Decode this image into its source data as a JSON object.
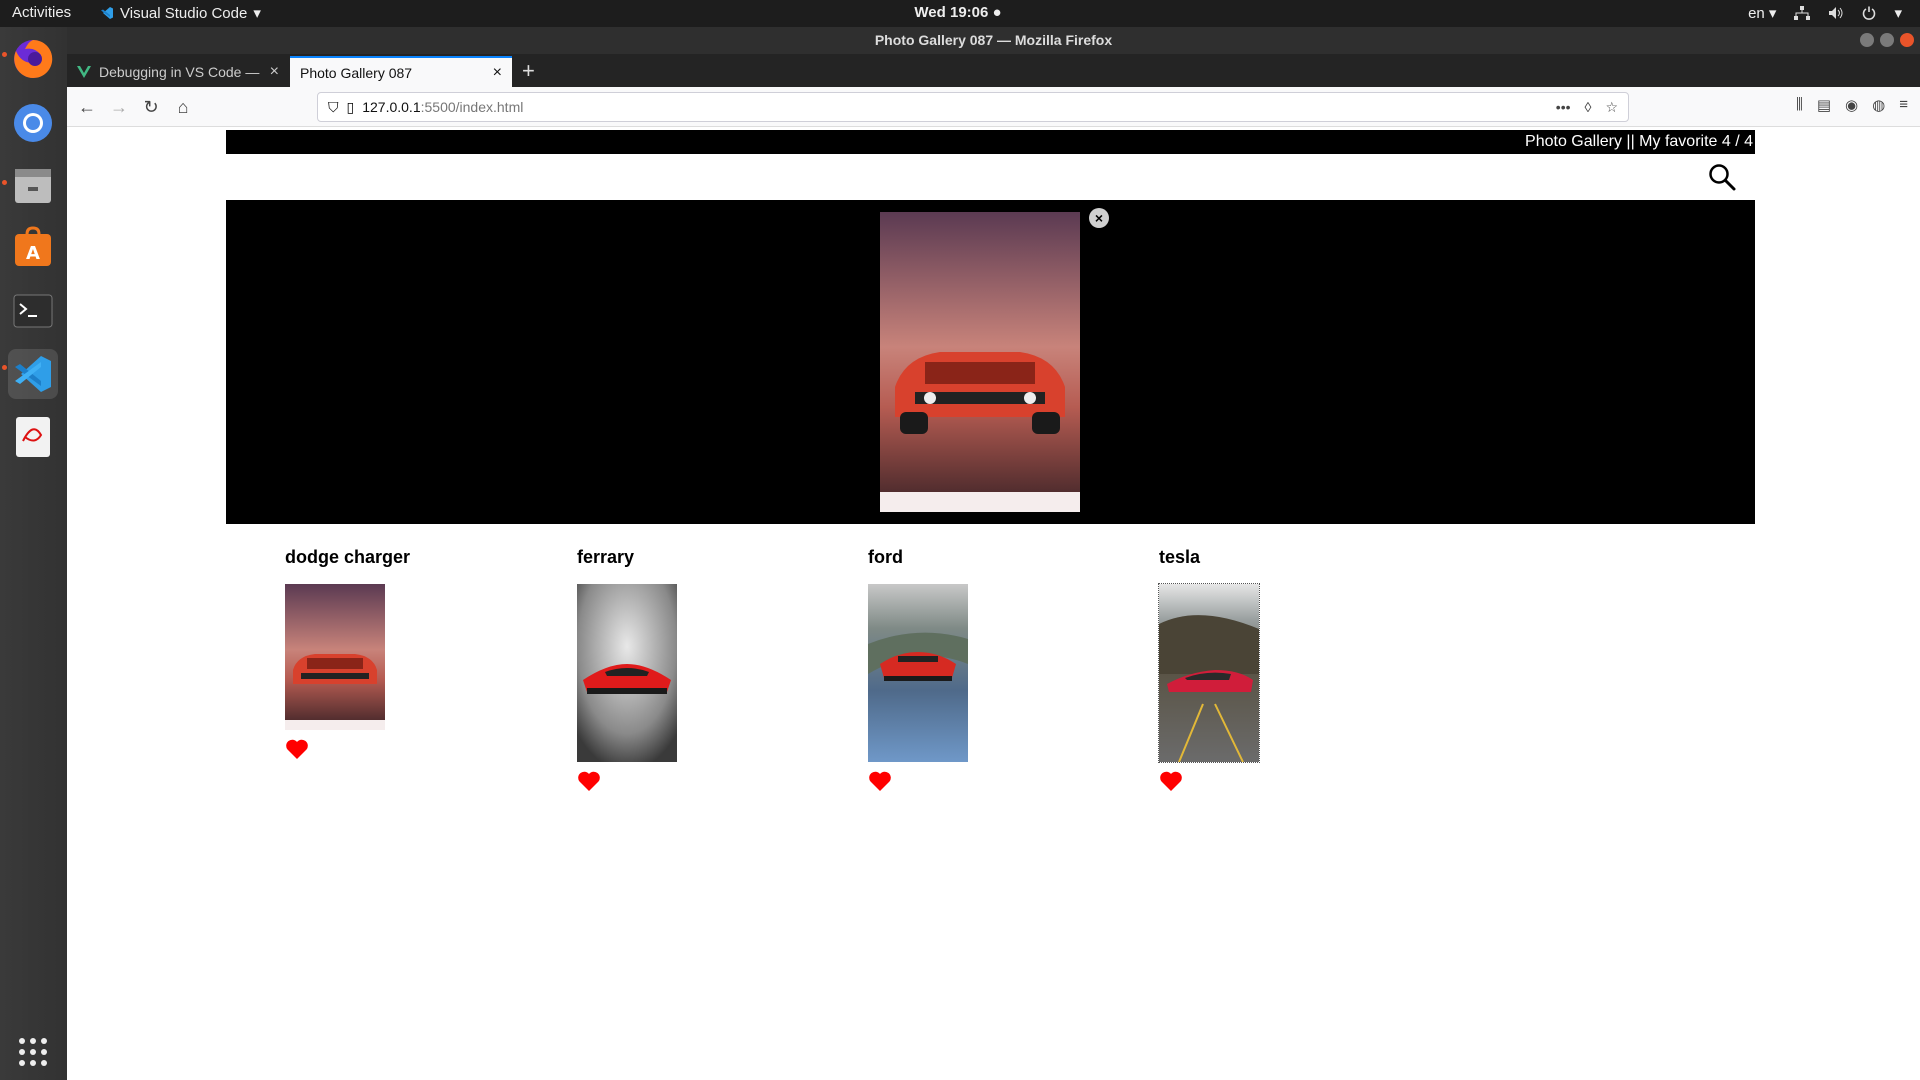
{
  "topbar": {
    "activities": "Activities",
    "app_name": "Visual Studio Code",
    "clock": "Wed 19:06",
    "lang": "en"
  },
  "window": {
    "title": "Photo Gallery 087 — Mozilla Firefox"
  },
  "tabs": [
    {
      "title": "Debugging in VS Code —"
    },
    {
      "title": "Photo Gallery 087"
    }
  ],
  "url": {
    "host": "127.0.0.1",
    "path": ":5500/index.html"
  },
  "page": {
    "header_text": "Photo Gallery || My favorite 4 / 4",
    "gallery": [
      {
        "title": "dodge charger",
        "favorite": true,
        "image": "orange muscle car at sunset"
      },
      {
        "title": "ferrary",
        "favorite": true,
        "image": "red supercar front view"
      },
      {
        "title": "ford",
        "favorite": true,
        "image": "red race car on track"
      },
      {
        "title": "tesla",
        "favorite": true,
        "image": "red roadster on mountain road"
      }
    ]
  },
  "colors": {
    "heart": "#ff0000",
    "accent": "#0a84ff",
    "dock_indicator": "#e9542a"
  }
}
